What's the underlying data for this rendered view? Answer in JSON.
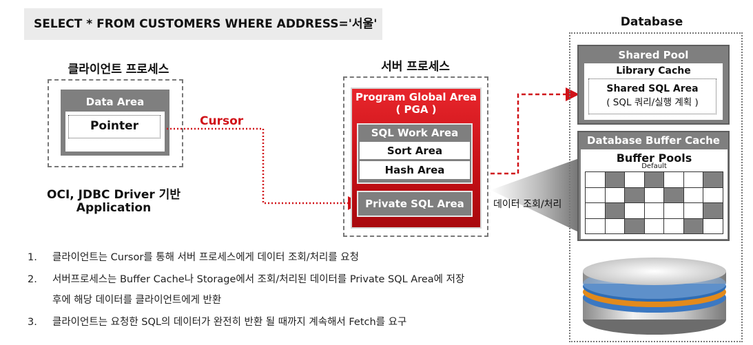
{
  "query": "SELECT * FROM CUSTOMERS WHERE ADDRESS='서울'",
  "client": {
    "heading": "클라이언트 프로세스",
    "data_area": "Data Area",
    "pointer": "Pointer",
    "caption_line1": "OCI, JDBC Driver 기반",
    "caption_line2": "Application"
  },
  "cursor_label": "Cursor",
  "server": {
    "heading": "서버 프로세스",
    "pga_line1": "Program Global Area",
    "pga_line2": "( PGA )",
    "sql_work_area": "SQL Work Area",
    "sort_area": "Sort Area",
    "hash_area": "Hash Area",
    "private_sql_area": "Private SQL Area"
  },
  "database": {
    "heading": "Database",
    "shared_pool": "Shared Pool",
    "library_cache": "Library Cache",
    "shared_sql_area": "Shared SQL Area",
    "shared_sql_note": "( SQL 쿼리/실행 계획 )",
    "buffer_cache": "Database Buffer Cache",
    "buffer_pools": "Buffer Pools",
    "default_label": "Default"
  },
  "beam_label": "데이터 조회/처리",
  "steps": [
    {
      "num": "1.",
      "text": "클라이언트는 Cursor를 통해 서버 프로세스에게 데이터 조회/처리를 요청"
    },
    {
      "num": "2.",
      "text": "서버프로세스는 Buffer Cache나 Storage에서 조회/처리된 데이터를 Private SQL Area에 저장"
    },
    {
      "num": "",
      "text": "후에 해당 데이터를 클라이언트에게 반환"
    },
    {
      "num": "3.",
      "text": "클라이언트는 요청한 SQL의 데이터가 완전히 반환 될 때까지 계속해서 Fetch를 요구"
    }
  ],
  "colors": {
    "accent_red": "#d01218",
    "box_gray": "#7f7f7f",
    "grid_dark": "#808080"
  }
}
